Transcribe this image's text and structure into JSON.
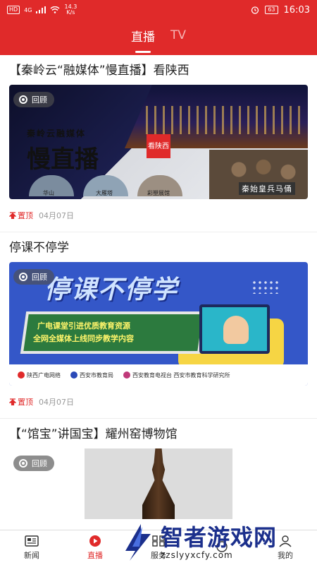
{
  "status_bar": {
    "hd": "HD",
    "network": "4G",
    "speed_value": "14.3",
    "speed_unit": "K/s",
    "battery": "63",
    "time": "16:03"
  },
  "top_tabs": [
    {
      "label": "直播",
      "active": true
    },
    {
      "label": "TV",
      "active": false
    }
  ],
  "feed": [
    {
      "title": "【秦岭云“融媒体”慢直播】看陕西",
      "replay_label": "回顾",
      "pinned_label": "置顶",
      "date": "04月07日",
      "image": {
        "brand": "秦岭云融媒体",
        "headline": "慢直播",
        "badge": "看陕西",
        "spots": [
          "华山",
          "大雁塔",
          "彩塑展馆"
        ],
        "feature": "秦始皇兵马俑"
      }
    },
    {
      "title": "停课不停学",
      "replay_label": "回顾",
      "pinned_label": "置顶",
      "date": "04月07日",
      "image": {
        "headline": "停课不停学",
        "line1": "广电课堂引进优质教育资源",
        "line2": "全网全媒体上线同步教学内容",
        "logos": [
          "陕西广电网络",
          "西安市教育局",
          "西安教育电视台 西安市教育科学研究所"
        ]
      }
    },
    {
      "title": "【“馆宝”讲国宝】耀州窑博物馆",
      "replay_label": "回顾"
    }
  ],
  "bottom_nav": [
    {
      "label": "新闻",
      "icon": "news-icon",
      "active": false
    },
    {
      "label": "直播",
      "icon": "play-icon",
      "active": true
    },
    {
      "label": "服务",
      "icon": "service-icon",
      "active": false
    },
    {
      "label": "",
      "icon": "",
      "active": false
    },
    {
      "label": "我的",
      "icon": "profile-icon",
      "active": false
    }
  ],
  "watermark": {
    "name": "智者游戏网",
    "url": "zzslyyxcfy.com"
  },
  "colors": {
    "brand_red": "#e02a2a",
    "watermark_blue": "#1b2f8c"
  }
}
